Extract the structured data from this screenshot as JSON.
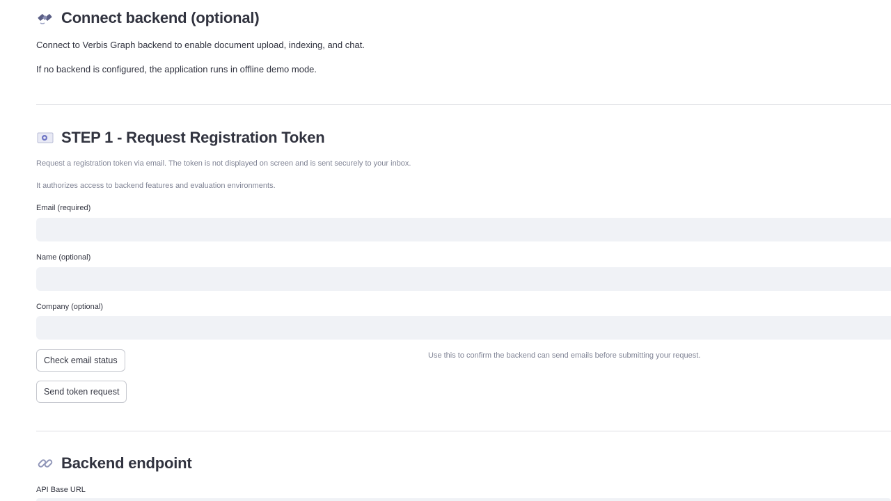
{
  "connect": {
    "icon": "satellite-icon",
    "title": "Connect backend (optional)",
    "para1": "Connect to Verbis Graph backend to enable document upload, indexing, and chat.",
    "para2": "If no backend is configured, the application runs in offline demo mode."
  },
  "step1": {
    "icon": "email-envelope-icon",
    "title": "STEP 1 - Request Registration Token",
    "caption1": "Request a registration token via email. The token is not displayed on screen and is sent securely to your inbox.",
    "caption2": "It authorizes access to backend features and evaluation environments.",
    "email_label": "Email (required)",
    "email_value": "",
    "name_label": "Name (optional)",
    "name_value": "",
    "company_label": "Company (optional)",
    "company_value": "",
    "check_button": "Check email status",
    "check_hint": "Use this to confirm the backend can send emails before submitting your request.",
    "send_button": "Send token request"
  },
  "endpoint": {
    "icon": "link-icon",
    "title": "Backend endpoint",
    "api_label": "API Base URL"
  }
}
